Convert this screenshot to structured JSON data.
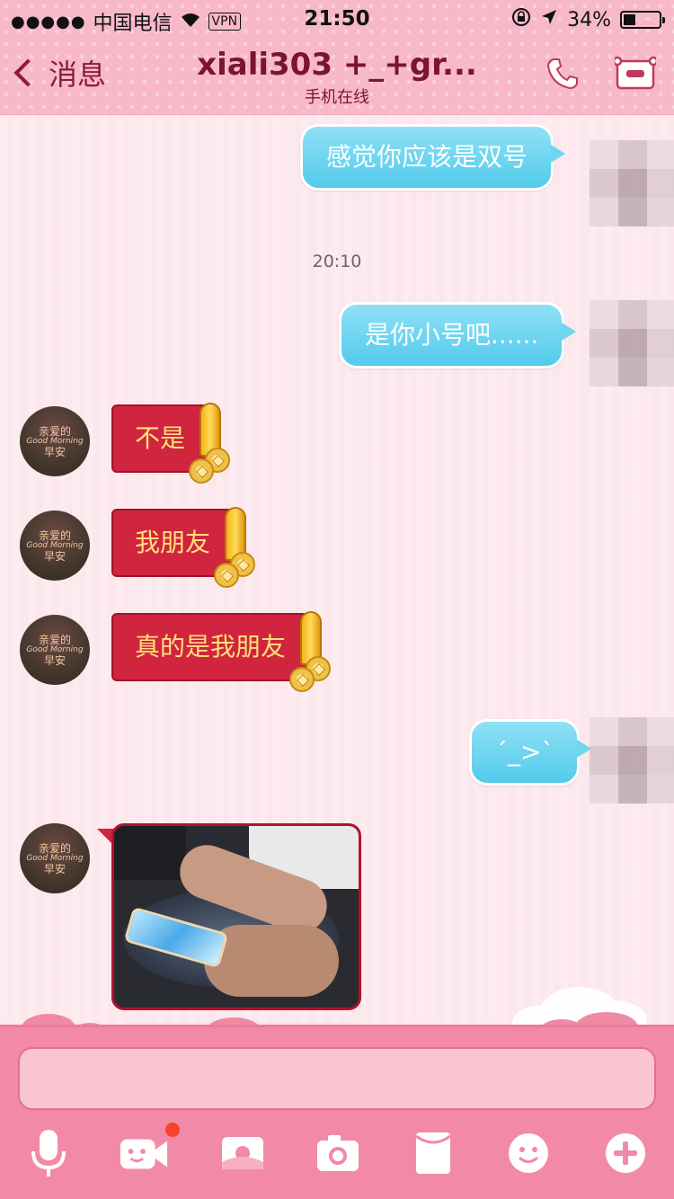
{
  "status_bar": {
    "carrier": "中国电信",
    "vpn": "VPN",
    "time": "21:50",
    "battery": "34%",
    "battery_level": 0.34
  },
  "header": {
    "back_label": "消息",
    "title": "xiali303   +_+gr...",
    "subtitle": "手机在线"
  },
  "messages": {
    "out_1": "感觉你应该是双号",
    "timestamp": "20:10",
    "out_2": "是你小号吧......",
    "in_1": "不是",
    "in_2": "我朋友",
    "in_3": "真的是我朋友",
    "out_3": "´_>`"
  },
  "contact_avatar": {
    "line1": "亲爱的",
    "line2": "Good Morning",
    "line3": "早安"
  },
  "toolbar_icons": [
    "microphone-icon",
    "video-call-icon",
    "photo-album-icon",
    "camera-icon",
    "red-envelope-icon",
    "emoji-icon",
    "plus-icon"
  ],
  "colors": {
    "header_bg": "#f7b8c9",
    "bubble_out": "#52cbec",
    "bubble_in": "#d0243f",
    "bubble_in_text": "#ffe07a",
    "bottom_bg": "#f28aa7"
  }
}
